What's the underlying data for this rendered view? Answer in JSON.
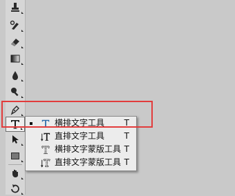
{
  "toolbar": {
    "tools": [
      {
        "name": "clone-stamp-icon"
      },
      {
        "name": "history-brush-icon"
      },
      {
        "name": "eraser-icon"
      },
      {
        "name": "gradient-icon"
      },
      {
        "name": "blur-icon"
      },
      {
        "name": "dodge-icon"
      },
      {
        "name": "pen-icon"
      },
      {
        "name": "type-tool-icon",
        "label": "T"
      },
      {
        "name": "path-selection-icon"
      },
      {
        "name": "rectangle-icon"
      },
      {
        "name": "hand-icon"
      },
      {
        "name": "rotate-view-icon"
      }
    ]
  },
  "flyout": {
    "items": [
      {
        "label": "横排文字工具",
        "shortcut": "T",
        "icon": "horizontal-type-icon",
        "selected": true
      },
      {
        "label": "直排文字工具",
        "shortcut": "T",
        "icon": "vertical-type-icon",
        "selected": false
      },
      {
        "label": "横排文字蒙版工具",
        "shortcut": "T",
        "icon": "horizontal-type-mask-icon",
        "selected": false
      },
      {
        "label": "直排文字蒙版工具",
        "shortcut": "T",
        "icon": "vertical-type-mask-icon",
        "selected": false
      }
    ]
  },
  "colors": {
    "highlight": "#e23b3b",
    "panel": "#ececec",
    "canvas": "#c9c9c9",
    "accent": "#2b6aa8"
  }
}
